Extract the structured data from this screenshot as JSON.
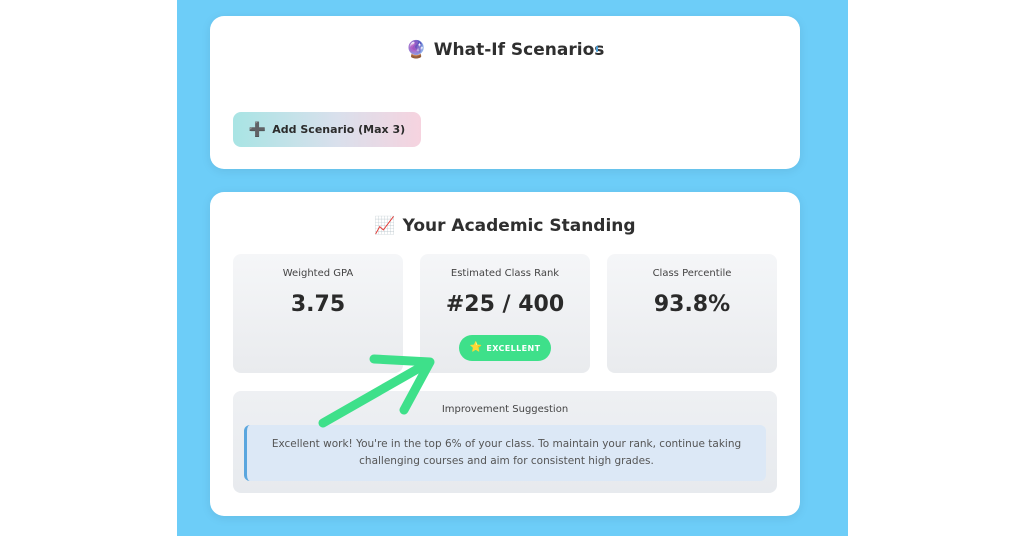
{
  "scenarios": {
    "title_icon": "crystal-ball-icon",
    "title_icon_glyph": "🔮",
    "title": "What-If Scenarios",
    "add_button_icon": "plus-icon",
    "add_button_icon_glyph": "➕",
    "add_button_label": "Add Scenario (Max 3)"
  },
  "standing": {
    "title_icon": "chart-increasing-icon",
    "title_icon_glyph": "📈",
    "title": "Your Academic Standing",
    "stats": [
      {
        "label": "Weighted GPA",
        "value": "3.75"
      },
      {
        "label": "Estimated Class Rank",
        "value": "#25 / 400"
      },
      {
        "label": "Class Percentile",
        "value": "93.8%"
      }
    ],
    "badge": {
      "icon": "star-icon",
      "icon_glyph": "⭐",
      "label": "EXCELLENT",
      "color": "#3ee08a"
    },
    "suggestion": {
      "title": "Improvement Suggestion",
      "text": "Excellent work! You're in the top 6% of your class. To maintain your rank, continue taking challenging courses and aim for consistent high grades."
    }
  },
  "colors": {
    "background": "#6dcdf8",
    "card": "#ffffff",
    "accent_green": "#3ee08a",
    "suggestion_border": "#5aa6de",
    "annotation_arrow": "#3ee08a"
  }
}
